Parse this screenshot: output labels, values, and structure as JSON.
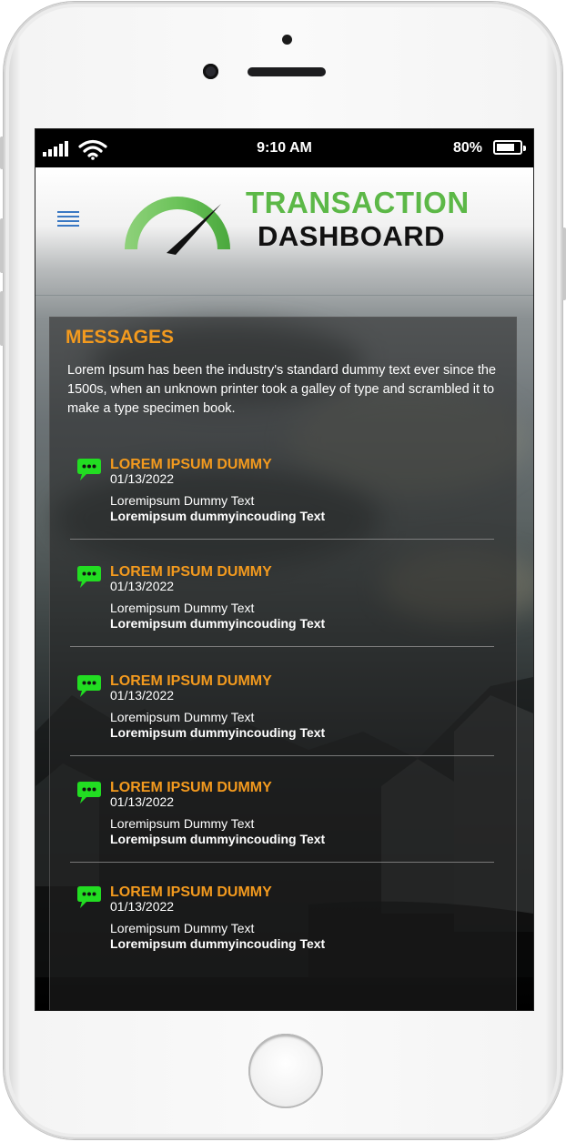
{
  "status_bar": {
    "time": "9:10 AM",
    "battery_percent": "80%",
    "battery_level": 0.8
  },
  "header": {
    "brand_line1": "TRANSACTION",
    "brand_line2": "DASHBOARD",
    "menu_icon": "hamburger-menu-icon",
    "logo_icon": "gauge-speedometer-icon",
    "colors": {
      "brand_green": "#5cb847",
      "menu_blue": "#3a78c3"
    }
  },
  "messages": {
    "title": "MESSAGES",
    "description": "Lorem Ipsum has been the industry's standard dummy text ever since the 1500s, when an unknown printer took a galley of type and scrambled it to make a type specimen book.",
    "accent_color": "#f39a1e",
    "icon": "chat-bubble-icon",
    "items": [
      {
        "title": "LOREM IPSUM DUMMY",
        "date": "01/13/2022",
        "line1": "Loremipsum Dummy Text",
        "line2": "Loremipsum dummyincouding Text"
      },
      {
        "title": "LOREM IPSUM DUMMY",
        "date": "01/13/2022",
        "line1": "Loremipsum Dummy Text",
        "line2": "Loremipsum dummyincouding Text"
      },
      {
        "title": "LOREM IPSUM DUMMY",
        "date": "01/13/2022",
        "line1": "Loremipsum Dummy Text",
        "line2": "Loremipsum dummyincouding Text"
      },
      {
        "title": "LOREM IPSUM DUMMY",
        "date": "01/13/2022",
        "line1": "Loremipsum Dummy Text",
        "line2": "Loremipsum dummyincouding Text"
      },
      {
        "title": "LOREM IPSUM DUMMY",
        "date": "01/13/2022",
        "line1": "Loremipsum Dummy Text",
        "line2": "Loremipsum dummyincouding Text"
      }
    ]
  }
}
